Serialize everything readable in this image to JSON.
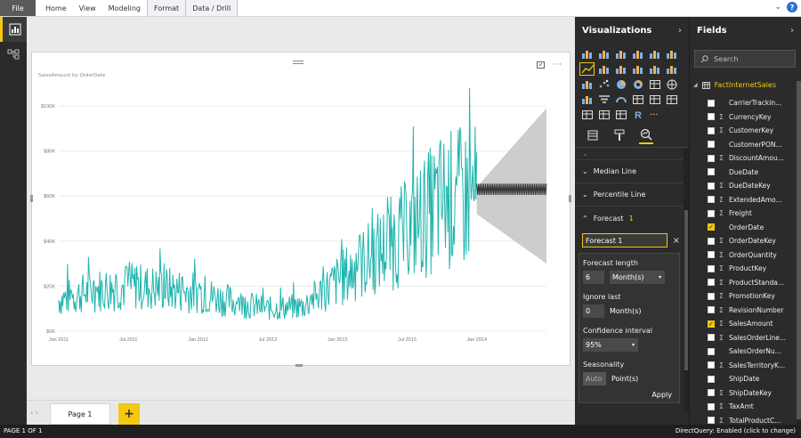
{
  "ribbon": {
    "file": "File",
    "tabs": [
      "Home",
      "View",
      "Modeling",
      "Format",
      "Data / Drill"
    ]
  },
  "chart_data": {
    "type": "line",
    "title": "SalesAmount by OrderDate",
    "y_ticks": [
      "$0K",
      "$20K",
      "$40K",
      "$60K",
      "$80K",
      "$100K"
    ],
    "x_ticks": [
      "Jan 2011",
      "Jul 2011",
      "Jan 2012",
      "Jul 2012",
      "Jan 2013",
      "Jul 2013",
      "Jan 2014"
    ],
    "ylim": [
      0,
      100000
    ],
    "x": [
      "2011-01",
      "2011-04",
      "2011-07",
      "2011-10",
      "2012-01",
      "2012-04",
      "2012-07",
      "2012-10",
      "2013-01",
      "2013-04",
      "2013-07",
      "2013-10",
      "2014-01"
    ],
    "series": [
      {
        "values": [
          14000,
          18000,
          20000,
          19000,
          17000,
          13000,
          10000,
          11000,
          22000,
          33000,
          44000,
          58000,
          60000
        ]
      }
    ],
    "forecast": {
      "start": "2014-01",
      "end": "2014-07",
      "value": 63000,
      "upper": [
        64000,
        99000
      ],
      "lower": [
        52000,
        30000
      ]
    },
    "series_color": "#1fb5ad",
    "forecast_band_color": "#c8c8c8"
  },
  "pagebar": {
    "page_label": "Page 1",
    "add_label": "+"
  },
  "status": {
    "left": "PAGE 1 OF 1",
    "right": "DirectQuery: Enabled (click to change)"
  },
  "viz": {
    "title": "Visualizations",
    "sections": {
      "median": "Median Line",
      "percentile": "Percentile Line",
      "forecast": "Forecast",
      "forecast_count": "1"
    },
    "forecast_name": "Forecast 1",
    "forecast_length_label": "Forecast length",
    "forecast_length_value": "6",
    "forecast_length_unit": "Month(s)",
    "ignore_last_label": "Ignore last",
    "ignore_last_value": "0",
    "ignore_last_unit": "Month(s)",
    "confidence_label": "Confidence interval",
    "confidence_value": "95%",
    "seasonality_label": "Seasonality",
    "seasonality_value": "Auto",
    "seasonality_unit": "Point(s)",
    "apply_label": "Apply"
  },
  "fields": {
    "title": "Fields",
    "search_placeholder": "Search",
    "table_name": "FactInternetSales",
    "items": [
      {
        "name": "CarrierTrackin...",
        "sigma": false,
        "checked": false
      },
      {
        "name": "CurrencyKey",
        "sigma": true,
        "checked": false
      },
      {
        "name": "CustomerKey",
        "sigma": true,
        "checked": false
      },
      {
        "name": "CustomerPON...",
        "sigma": false,
        "checked": false
      },
      {
        "name": "DiscountAmou...",
        "sigma": true,
        "checked": false
      },
      {
        "name": "DueDate",
        "sigma": false,
        "checked": false
      },
      {
        "name": "DueDateKey",
        "sigma": true,
        "checked": false
      },
      {
        "name": "ExtendedAmo...",
        "sigma": true,
        "checked": false
      },
      {
        "name": "Freight",
        "sigma": true,
        "checked": false
      },
      {
        "name": "OrderDate",
        "sigma": false,
        "checked": true
      },
      {
        "name": "OrderDateKey",
        "sigma": true,
        "checked": false
      },
      {
        "name": "OrderQuantity",
        "sigma": true,
        "checked": false
      },
      {
        "name": "ProductKey",
        "sigma": true,
        "checked": false
      },
      {
        "name": "ProductStanda...",
        "sigma": true,
        "checked": false
      },
      {
        "name": "PromotionKey",
        "sigma": true,
        "checked": false
      },
      {
        "name": "RevisionNumber",
        "sigma": true,
        "checked": false
      },
      {
        "name": "SalesAmount",
        "sigma": true,
        "checked": true
      },
      {
        "name": "SalesOrderLine...",
        "sigma": true,
        "checked": false
      },
      {
        "name": "SalesOrderNu...",
        "sigma": false,
        "checked": false
      },
      {
        "name": "SalesTerritoryK...",
        "sigma": true,
        "checked": false
      },
      {
        "name": "ShipDate",
        "sigma": false,
        "checked": false
      },
      {
        "name": "ShipDateKey",
        "sigma": true,
        "checked": false
      },
      {
        "name": "TaxAmt",
        "sigma": true,
        "checked": false
      },
      {
        "name": "TotalProductC...",
        "sigma": true,
        "checked": false
      }
    ]
  }
}
